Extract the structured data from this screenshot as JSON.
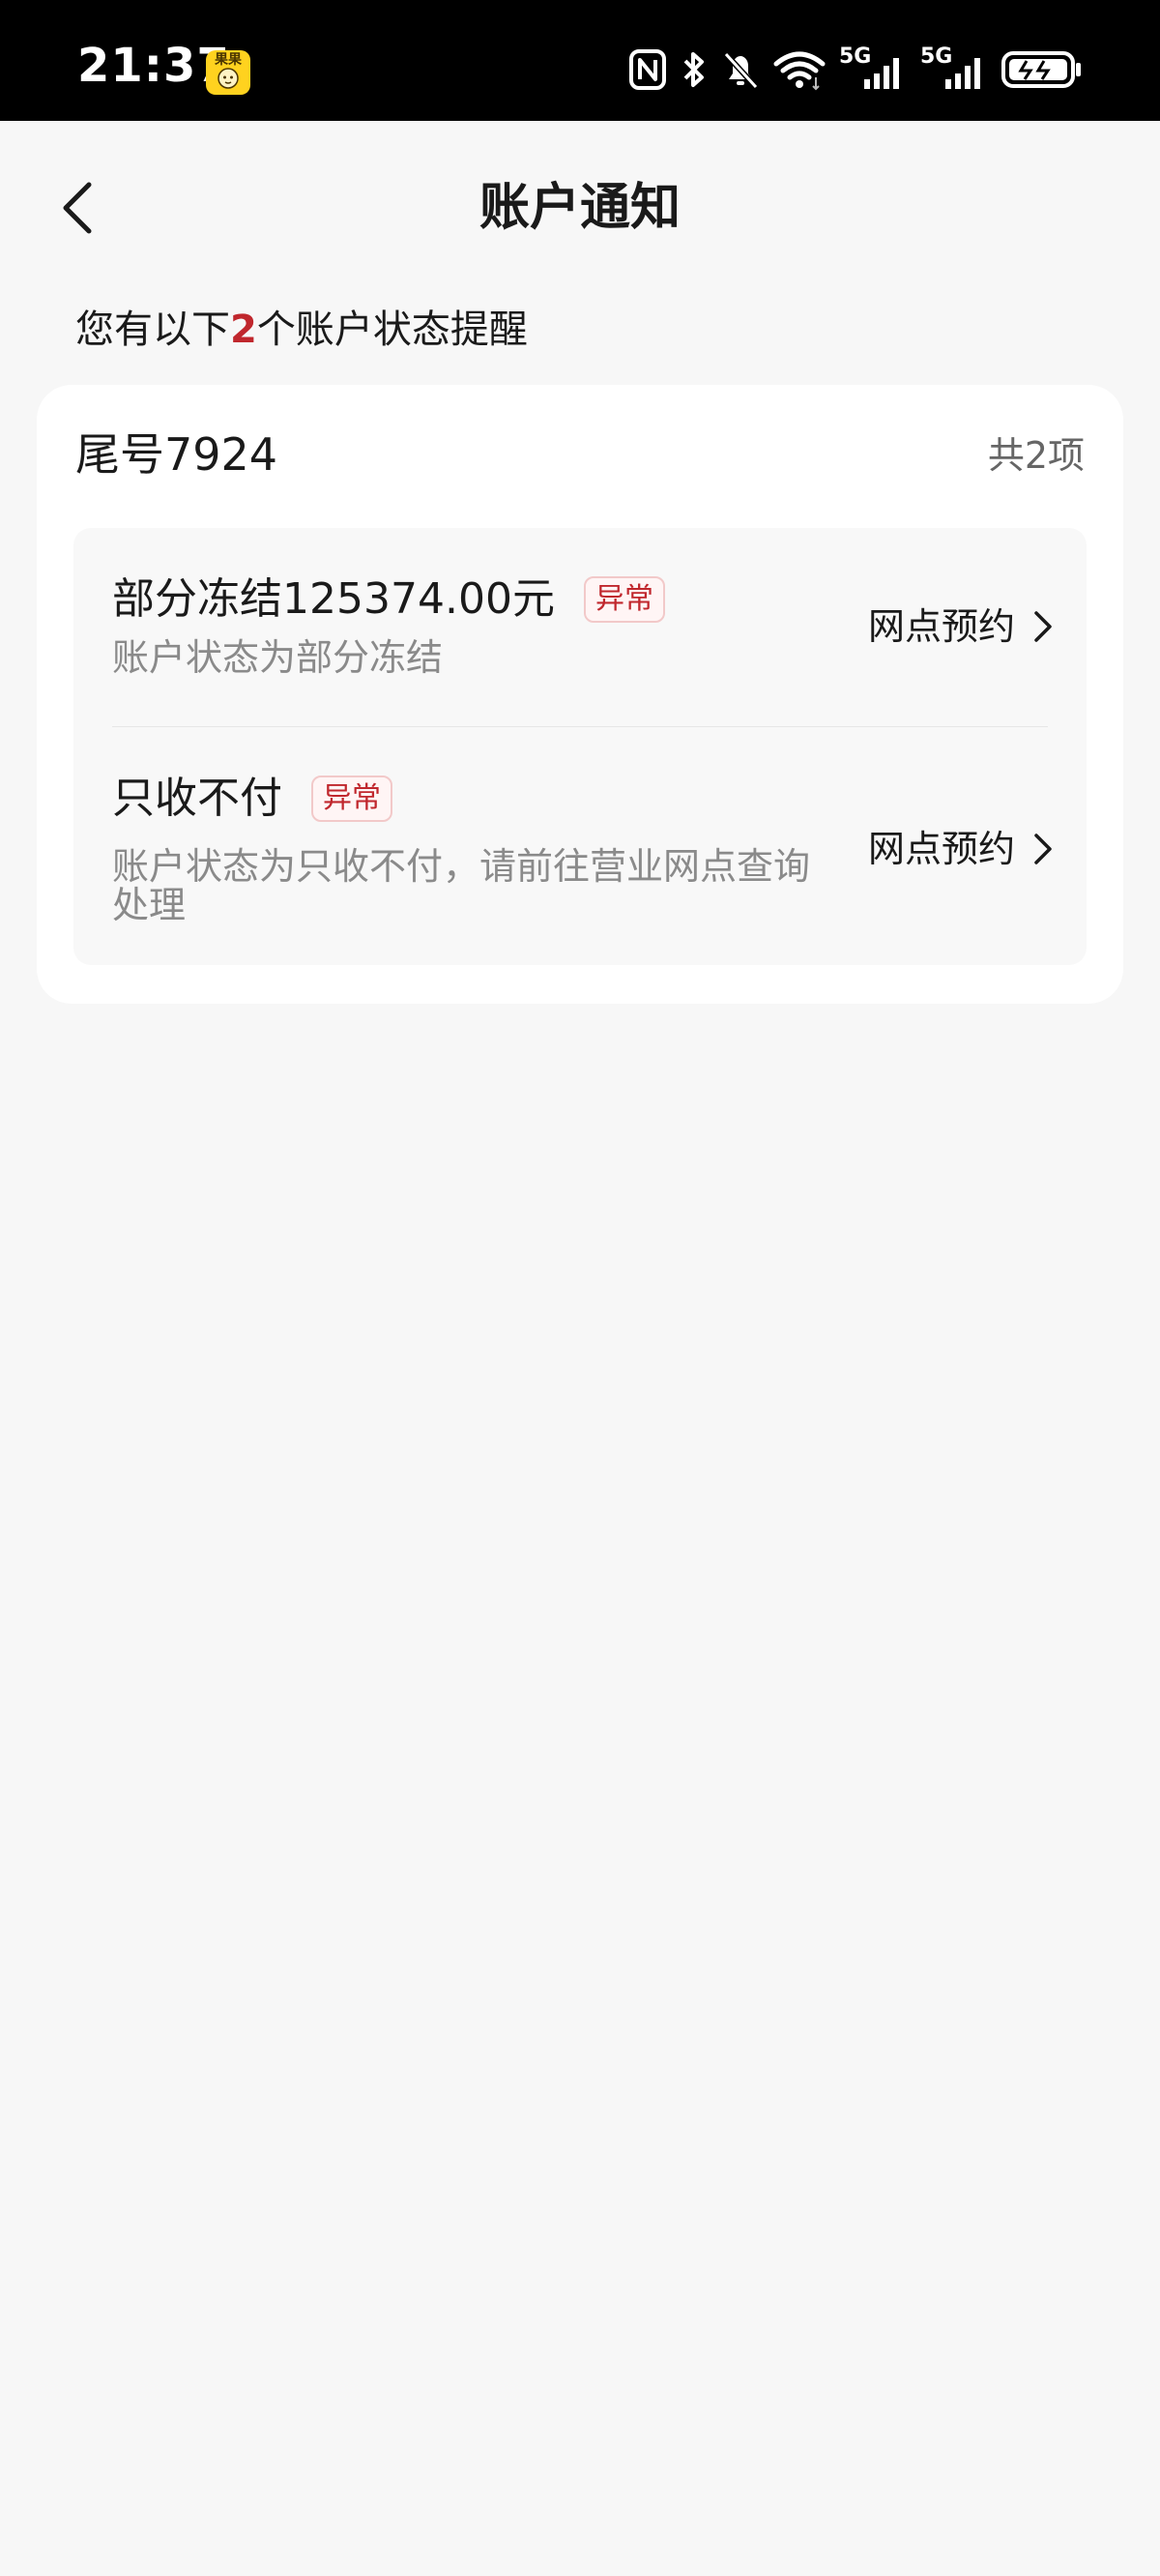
{
  "status_bar": {
    "time": "21:37",
    "app_badge_text": "果果",
    "network_1": "5G",
    "network_2": "5G"
  },
  "header": {
    "title": "账户通知"
  },
  "summary": {
    "prefix": "您有以下",
    "count": "2",
    "suffix": "个账户状态提醒"
  },
  "account": {
    "title": "尾号7924",
    "count_label": "共2项",
    "items": [
      {
        "title": "部分冻结125374.00元",
        "tag": "异常",
        "description": "账户状态为部分冻结",
        "action": "网点预约"
      },
      {
        "title": "只收不付",
        "tag": "异常",
        "description": "账户状态为只收不付，请前往营业网点查询处理",
        "action": "网点预约"
      }
    ]
  },
  "colors": {
    "accent_red": "#c0272d",
    "page_background": "#f7f7f7",
    "card_background": "#ffffff",
    "secondary_text": "#8a8a8a"
  },
  "icons": {
    "status": [
      "nfc-icon",
      "bluetooth-icon",
      "bell-muted-icon",
      "wifi-icon",
      "signal-icon",
      "signal-icon",
      "battery-charging-icon"
    ],
    "back": "chevron-left-icon",
    "action": "chevron-right-icon"
  }
}
